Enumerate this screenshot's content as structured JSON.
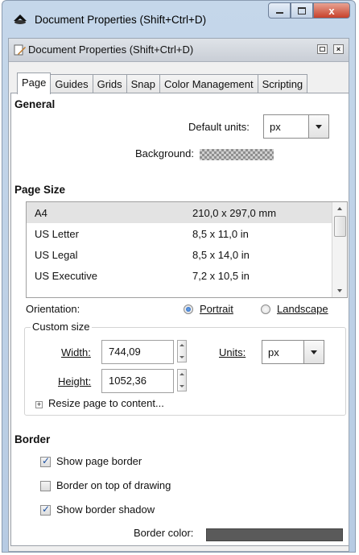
{
  "window": {
    "title": "Document Properties (Shift+Ctrl+D)",
    "close_glyph": "x"
  },
  "dock": {
    "title": "Document Properties (Shift+Ctrl+D)"
  },
  "tabs": [
    "Page",
    "Guides",
    "Grids",
    "Snap",
    "Color Management",
    "Scripting"
  ],
  "general": {
    "heading": "General",
    "default_units_label": "Default units:",
    "default_units_value": "px",
    "background_label": "Background:"
  },
  "page_size": {
    "heading": "Page Size",
    "rows": [
      {
        "name": "A4",
        "dims": "210,0 x 297,0 mm",
        "selected": true
      },
      {
        "name": "US Letter",
        "dims": "8,5 x 11,0 in",
        "selected": false
      },
      {
        "name": "US Legal",
        "dims": "8,5 x 14,0 in",
        "selected": false
      },
      {
        "name": "US Executive",
        "dims": "7,2 x 10,5 in",
        "selected": false
      }
    ],
    "orientation_label": "Orientation:",
    "portrait_label": "Portrait",
    "landscape_label": "Landscape",
    "orientation_selected": "Portrait"
  },
  "custom_size": {
    "legend": "Custom size",
    "width_label": "Width:",
    "width_value": "744,09",
    "height_label": "Height:",
    "height_value": "1052,36",
    "units_label": "Units:",
    "units_value": "px",
    "resize_label": "Resize page to content...",
    "expander_glyph": "+"
  },
  "border": {
    "heading": "Border",
    "show_page_border": "Show page border",
    "show_page_border_checked": true,
    "border_on_top": "Border on top of drawing",
    "border_on_top_checked": false,
    "show_border_shadow": "Show border shadow",
    "show_border_shadow_checked": true,
    "border_color_label": "Border color:"
  },
  "colors": {
    "border_color": "#5a5a5a",
    "selected_row": "#e3e3e3",
    "radio_accent": "#1f5fbf"
  },
  "icons": {
    "app": "inkscape-logo-icon",
    "dock": "document-properties-icon"
  }
}
